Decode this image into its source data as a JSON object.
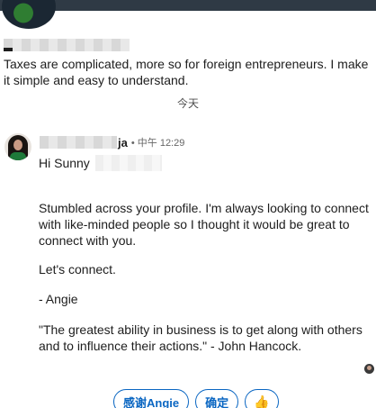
{
  "intro": {
    "text": "Taxes are complicated, more so for foreign entrepreneurs. I make it simple and easy to understand."
  },
  "divider": {
    "label": "今天"
  },
  "message": {
    "sender_visible_suffix": "ja",
    "separator": "•",
    "time": "中午 12:29",
    "greeting": "Hi Sunny",
    "paragraphs": [
      "Stumbled across your profile. I'm always looking to connect with like-minded people so I thought it would be great to connect with you.",
      "Let's connect.",
      "- Angie",
      "\"The greatest ability in business is to get along with others and to influence their actions.\" - John Hancock."
    ]
  },
  "quick_replies": {
    "thanks": "感谢Angie",
    "ok": "确定",
    "thumb": "👍"
  },
  "icons": {
    "seen": "seen-avatar-icon",
    "thumb": "thumbs-up-icon"
  },
  "colors": {
    "accent": "#0a66c2",
    "top_bar": "#2f3a45"
  }
}
